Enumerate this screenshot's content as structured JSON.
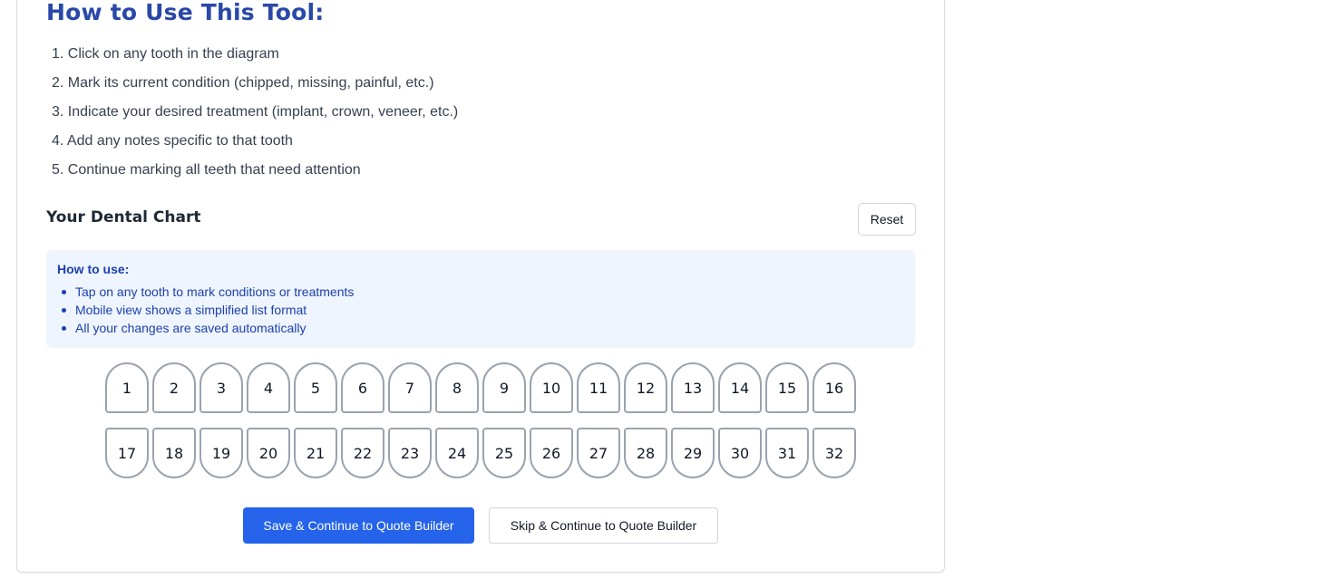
{
  "instructions": {
    "title": "How to Use This Tool:",
    "steps": [
      "1. Click on any tooth in the diagram",
      "2. Mark its current condition (chipped, missing, painful, etc.)",
      "3. Indicate your desired treatment (implant, crown, veneer, etc.)",
      "4. Add any notes specific to that tooth",
      "5. Continue marking all teeth that need attention"
    ]
  },
  "chart": {
    "title": "Your Dental Chart",
    "reset_label": "Reset"
  },
  "help": {
    "title": "How to use:",
    "items": [
      "Tap on any tooth to mark conditions or treatments",
      "Mobile view shows a simplified list format",
      "All your changes are saved automatically"
    ]
  },
  "teeth": {
    "upper": [
      "1",
      "2",
      "3",
      "4",
      "5",
      "6",
      "7",
      "8",
      "9",
      "10",
      "11",
      "12",
      "13",
      "14",
      "15",
      "16"
    ],
    "lower": [
      "17",
      "18",
      "19",
      "20",
      "21",
      "22",
      "23",
      "24",
      "25",
      "26",
      "27",
      "28",
      "29",
      "30",
      "31",
      "32"
    ]
  },
  "actions": {
    "save_label": "Save & Continue to Quote Builder",
    "skip_label": "Skip & Continue to Quote Builder"
  },
  "colors": {
    "heading": "#2948a8",
    "primary": "#2563eb",
    "help_bg": "#eef5fe",
    "help_text": "#1e40af",
    "tooth_border": "#9aa3ae"
  }
}
